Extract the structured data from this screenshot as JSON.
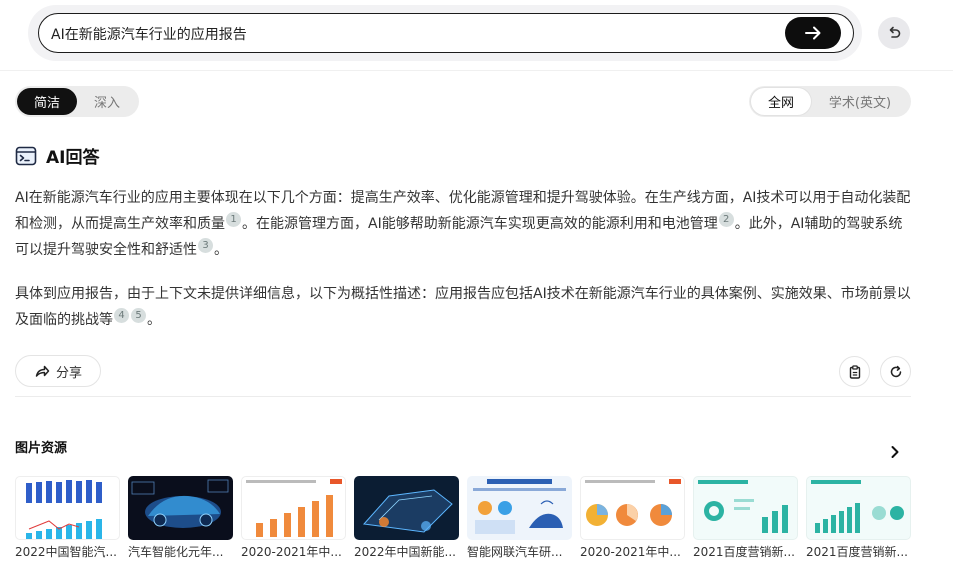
{
  "search": {
    "query": "AI在新能源汽车行业的应用报告",
    "submit_icon": "arrow-right-icon",
    "undo_icon": "undo-icon"
  },
  "modes": {
    "left": [
      "简洁",
      "深入"
    ],
    "left_selected": "简洁",
    "right": [
      "全网",
      "学术(英文)"
    ],
    "right_selected": "全网"
  },
  "answer": {
    "title": "AI回答",
    "icon": "terminal-icon",
    "p1": [
      "AI在新能源汽车行业的应用主要体现在以下几个方面：提高生产效率、优化能源管理和提升驾驶体验。在生产线方面，AI技术可以用于自动化装配和检测，从而提高生产效率和质量",
      "1",
      "。在能源管理方面，AI能够帮助新能源汽车实现更高效的能源利用和电池管理",
      "2",
      "。此外，AI辅助的驾驶系统可以提升驾驶安全性和舒适性",
      "3",
      "。"
    ],
    "p2": [
      "具体到应用报告，由于上下文未提供详细信息，以下为概括性描述：应用报告应包括AI技术在新能源汽车行业的具体案例、实施效果、市场前景以及面临的挑战等",
      "4",
      "5",
      "。"
    ]
  },
  "actions": {
    "share_label": "分享",
    "share_icon": "share-icon",
    "copy_icon": "clipboard-icon",
    "regenerate_icon": "refresh-icon"
  },
  "images": {
    "section_title": "图片资源",
    "next_icon": "chevron-right-icon",
    "items": [
      {
        "caption": "2022中国智能汽..."
      },
      {
        "caption": "汽车智能化元年..."
      },
      {
        "caption": "2020-2021年中..."
      },
      {
        "caption": "2022年中国新能..."
      },
      {
        "caption": "智能网联汽车研..."
      },
      {
        "caption": "2020-2021年中..."
      },
      {
        "caption": "2021百度营销新..."
      },
      {
        "caption": "2021百度营销新..."
      }
    ]
  },
  "colors": {
    "accent_dark": "#0d0d0d",
    "citation_bg": "#d7dede",
    "chart_blue": "#2f6fd6",
    "chart_orange": "#f08a3c",
    "chart_teal": "#2cb3a3"
  }
}
